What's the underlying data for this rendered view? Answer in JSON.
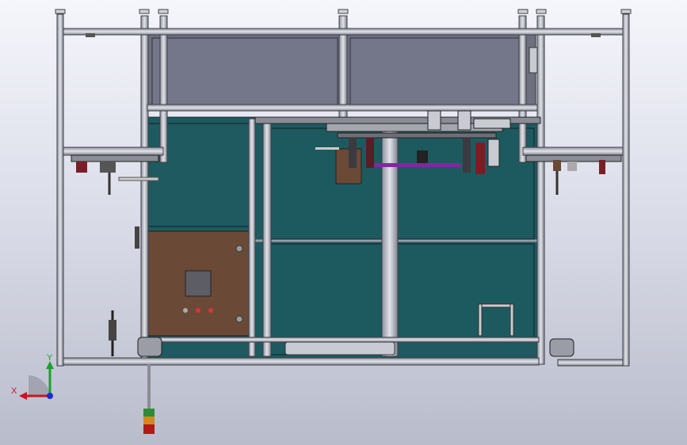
{
  "viewport": {
    "background_top": "#f5f6fb",
    "background_bottom": "#b9bccb",
    "model_panel_color": "#1e5a60",
    "cabinet_color": "#6a4a36",
    "frame_color": "#a9acb6"
  },
  "triad": {
    "x_label": "X",
    "y_label": "Y",
    "x_color": "#c8161b",
    "y_color": "#1aa12b",
    "z_color": "#1d2bd0"
  },
  "tower_light": {
    "colors": [
      "#2e8b3a",
      "#d18a1e",
      "#b01a1a"
    ]
  }
}
